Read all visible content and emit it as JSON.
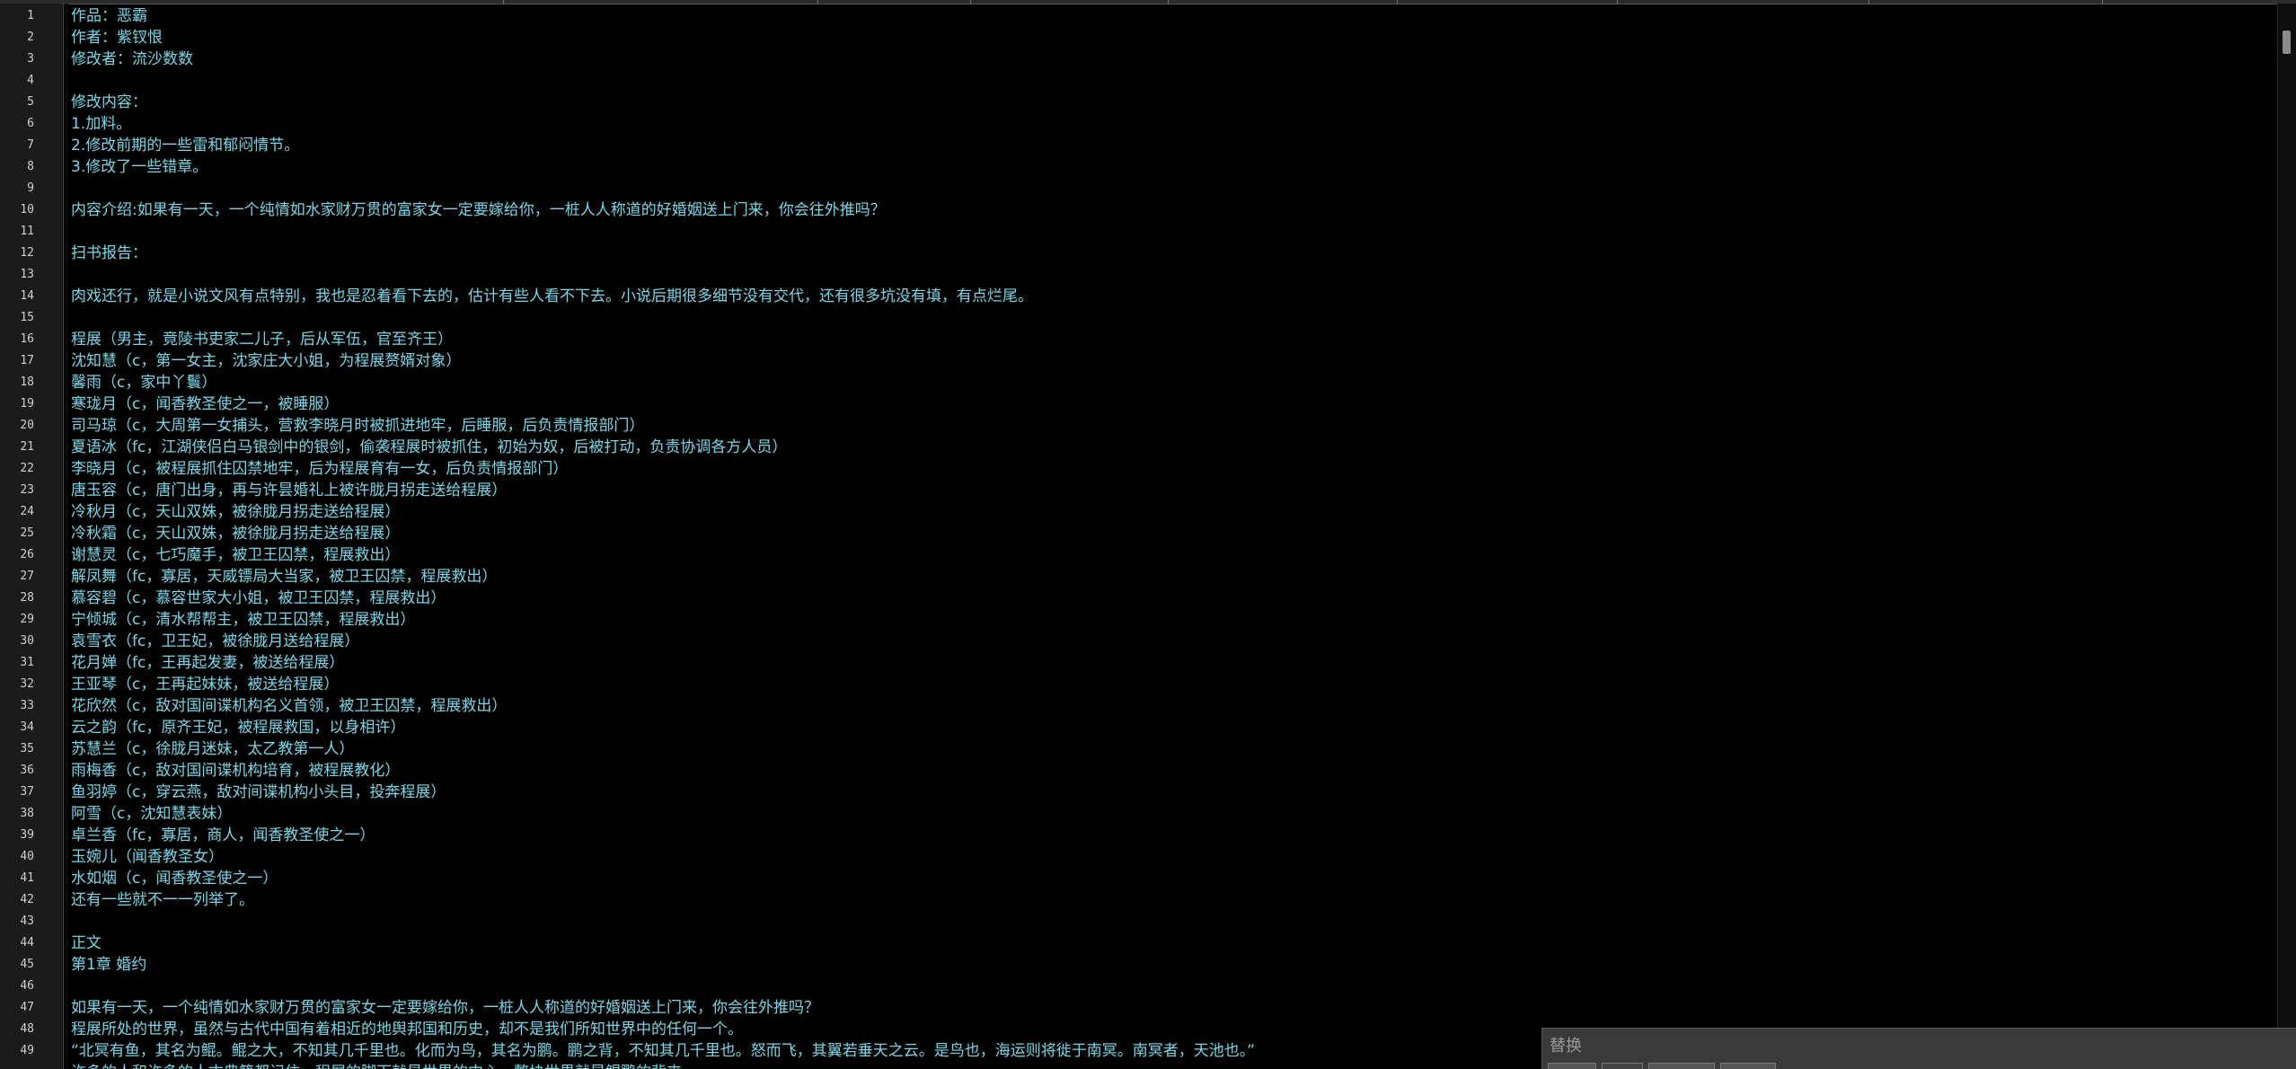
{
  "editor": {
    "lines": [
      {
        "n": "1",
        "text": "作品：恶霸"
      },
      {
        "n": "2",
        "text": "作者：紫钗恨"
      },
      {
        "n": "3",
        "text": "修改者：流沙数数"
      },
      {
        "n": "4",
        "text": ""
      },
      {
        "n": "5",
        "text": "修改内容："
      },
      {
        "n": "6",
        "text": "1.加料。"
      },
      {
        "n": "7",
        "text": "2.修改前期的一些雷和郁闷情节。"
      },
      {
        "n": "8",
        "text": "3.修改了一些错章。"
      },
      {
        "n": "9",
        "text": ""
      },
      {
        "n": "10",
        "text": "内容介绍:如果有一天，一个纯情如水家财万贯的富家女一定要嫁给你，一桩人人称道的好婚姻送上门来，你会往外推吗？"
      },
      {
        "n": "11",
        "text": ""
      },
      {
        "n": "12",
        "text": "扫书报告："
      },
      {
        "n": "13",
        "text": ""
      },
      {
        "n": "14",
        "text": "肉戏还行，就是小说文风有点特别，我也是忍着看下去的，估计有些人看不下去。小说后期很多细节没有交代，还有很多坑没有填，有点烂尾。"
      },
      {
        "n": "15",
        "text": ""
      },
      {
        "n": "16",
        "text": "程展（男主，竟陵书吏家二儿子，后从军伍，官至齐王）"
      },
      {
        "n": "17",
        "text": "沈知慧（c，第一女主，沈家庄大小姐，为程展赘婿对象）"
      },
      {
        "n": "18",
        "text": "馨雨（c，家中丫鬟）"
      },
      {
        "n": "19",
        "text": "寒珑月（c，闻香教圣使之一，被睡服）"
      },
      {
        "n": "20",
        "text": "司马琼（c，大周第一女捕头，营救李晓月时被抓进地牢，后睡服，后负责情报部门）"
      },
      {
        "n": "21",
        "text": "夏语冰（fc，江湖侠侣白马银剑中的银剑，偷袭程展时被抓住，初始为奴，后被打动，负责协调各方人员）"
      },
      {
        "n": "22",
        "text": "李晓月（c，被程展抓住囚禁地牢，后为程展育有一女，后负责情报部门）"
      },
      {
        "n": "23",
        "text": "唐玉容（c，唐门出身，再与许昙婚礼上被许胧月拐走送给程展）"
      },
      {
        "n": "24",
        "text": "冷秋月（c，天山双姝，被徐胧月拐走送给程展）"
      },
      {
        "n": "25",
        "text": "冷秋霜（c，天山双姝，被徐胧月拐走送给程展）"
      },
      {
        "n": "26",
        "text": "谢慧灵（c，七巧魔手，被卫王囚禁，程展救出）"
      },
      {
        "n": "27",
        "text": "解凤舞（fc，寡居，天威镖局大当家，被卫王囚禁，程展救出）"
      },
      {
        "n": "28",
        "text": "慕容碧（c，慕容世家大小姐，被卫王囚禁，程展救出）"
      },
      {
        "n": "29",
        "text": "宁倾城（c，清水帮帮主，被卫王囚禁，程展救出）"
      },
      {
        "n": "30",
        "text": "袁雪衣（fc，卫王妃，被徐胧月送给程展）"
      },
      {
        "n": "31",
        "text": "花月婵（fc，王再起发妻，被送给程展）"
      },
      {
        "n": "32",
        "text": "王亚琴（c，王再起妹妹，被送给程展）"
      },
      {
        "n": "33",
        "text": "花欣然（c，敌对国间谍机构名义首领，被卫王囚禁，程展救出）"
      },
      {
        "n": "34",
        "text": "云之韵（fc，原齐王妃，被程展救国，以身相许）"
      },
      {
        "n": "35",
        "text": "苏慧兰（c，徐胧月迷妹，太乙教第一人）"
      },
      {
        "n": "36",
        "text": "雨梅香（c，敌对国间谍机构培育，被程展教化）"
      },
      {
        "n": "37",
        "text": "鱼羽婷（c，穿云燕，敌对间谍机构小头目，投奔程展）"
      },
      {
        "n": "38",
        "text": "阿雪（c，沈知慧表妹）"
      },
      {
        "n": "39",
        "text": "卓兰香（fc，寡居，商人，闻香教圣使之一）"
      },
      {
        "n": "40",
        "text": "玉婉儿（闻香教圣女）"
      },
      {
        "n": "41",
        "text": "水如烟（c，闻香教圣使之一）"
      },
      {
        "n": "42",
        "text": "还有一些就不一一列举了。"
      },
      {
        "n": "43",
        "text": ""
      },
      {
        "n": "44",
        "text": "正文"
      },
      {
        "n": "45",
        "text": "第1章 婚约"
      },
      {
        "n": "46",
        "text": ""
      },
      {
        "n": "47",
        "text": "如果有一天，一个纯情如水家财万贯的富家女一定要嫁给你，一桩人人称道的好婚姻送上门来，你会往外推吗？"
      },
      {
        "n": "48",
        "text": "程展所处的世界，虽然与古代中国有着相近的地舆邦国和历史，却不是我们所知世界中的任何一个。"
      },
      {
        "n": "49",
        "text": "“北冥有鱼，其名为鲲。鲲之大，不知其几千里也。化而为鸟，其名为鹏。鹏之背，不知其几千里也。怒而飞，其翼若垂天之云。是鸟也，海运则将徙于南冥。南冥者，天池也。”"
      },
      {
        "n": "",
        "text": "许多的人和许多的人古典籍都记住，程展的脚下就是世界的中心，整块世界就是鲲鹏的背夹"
      }
    ]
  },
  "replace_panel": {
    "title": "替换"
  },
  "colors": {
    "text": "#7ad6e6",
    "background": "#000000",
    "gutter_bg": "#1b1b1b",
    "line_number": "#cfcfcf"
  }
}
